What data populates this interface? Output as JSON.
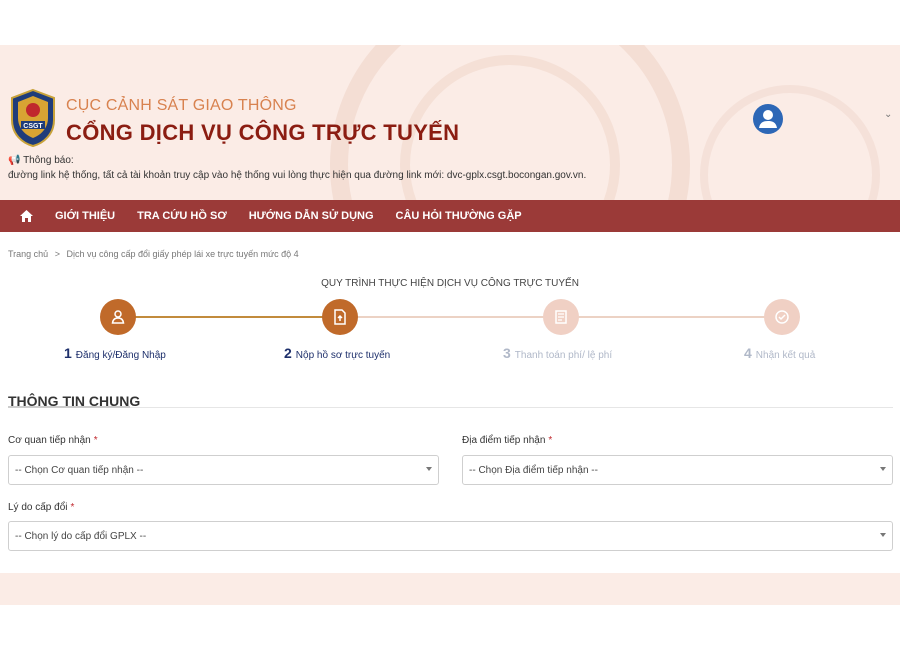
{
  "header": {
    "org_title": "CỤC CẢNH SÁT GIAO THÔNG",
    "portal_title": "CỔNG DỊCH VỤ CÔNG TRỰC TUYẾN",
    "logo_text": "CSGT",
    "notice_label": "Thông báo:",
    "notice_text": "đường link hệ thống, tất cả tài khoản truy cập vào hệ thống vui lòng thực hiện qua đường link mới: dvc-gplx.csgt.bocongan.gov.vn."
  },
  "nav": {
    "items": [
      {
        "label": "GIỚI THIỆU"
      },
      {
        "label": "TRA CỨU HỒ SƠ"
      },
      {
        "label": "HƯỚNG DẪN SỬ DỤNG"
      },
      {
        "label": "CÂU HỎI THƯỜNG GẶP"
      }
    ]
  },
  "breadcrumb": {
    "home": "Trang chủ",
    "separator": ">",
    "current": "Dịch vụ công cấp đổi giấy phép lái xe trực tuyến mức độ 4"
  },
  "process": {
    "title": "QUY TRÌNH THỰC HIỆN DỊCH VỤ CÔNG TRỰC TUYẾN",
    "steps": [
      {
        "num": "1",
        "label": "Đăng ký/Đăng Nhập",
        "state": "done"
      },
      {
        "num": "2",
        "label": "Nộp hồ sơ trực tuyến",
        "state": "done"
      },
      {
        "num": "3",
        "label": "Thanh toán phí/ lệ phí",
        "state": "todo"
      },
      {
        "num": "4",
        "label": "Nhận kết quả",
        "state": "todo"
      }
    ]
  },
  "form": {
    "section_title": "THÔNG TIN CHUNG",
    "required_mark": "*",
    "agency_label": "Cơ quan tiếp nhận",
    "agency_value": "-- Chọn Cơ quan tiếp nhận --",
    "location_label": "Địa điểm tiếp nhận",
    "location_value": "-- Chọn Địa điểm tiếp nhận --",
    "reason_label": "Lý do cấp đổi",
    "reason_value": "-- Chọn lý do cấp đổi GPLX --"
  },
  "colors": {
    "nav_bg": "#9b3a38",
    "step_done": "#c06a2a",
    "step_todo": "#f0d0c4",
    "brand_dark": "#8b1d12",
    "brand_light": "#d8824f"
  }
}
